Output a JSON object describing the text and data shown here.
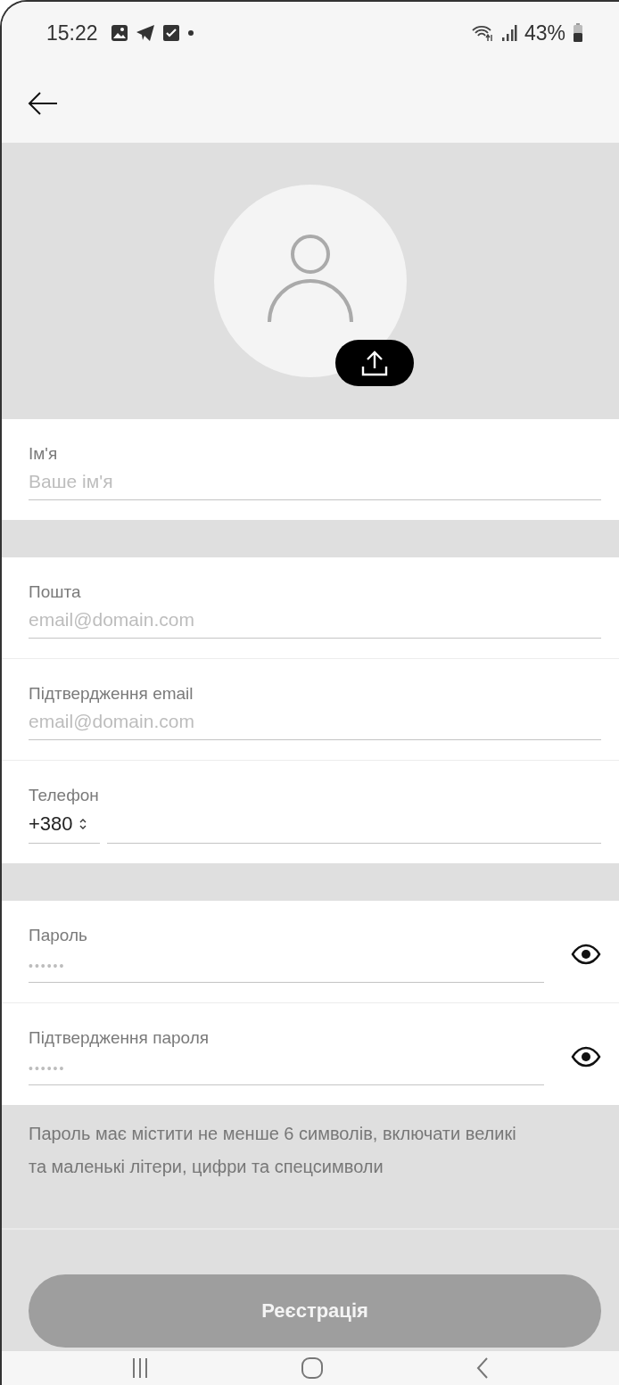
{
  "status_bar": {
    "time": "15:22",
    "battery": "43%"
  },
  "avatar": {
    "upload": true
  },
  "groups": [
    {
      "fields": [
        {
          "kind": "text",
          "label": "Ім'я",
          "placeholder": "Ваше ім'я"
        }
      ]
    },
    {
      "fields": [
        {
          "kind": "text",
          "label": "Пошта",
          "placeholder": "email@domain.com"
        },
        {
          "kind": "text",
          "label": "Підтвердження email",
          "placeholder": "email@domain.com"
        },
        {
          "kind": "phone",
          "label": "Телефон",
          "code": "+380"
        }
      ]
    },
    {
      "fields": [
        {
          "kind": "password",
          "label": "Пароль",
          "placeholder": "••••••"
        },
        {
          "kind": "password",
          "label": "Підтвердження пароля",
          "placeholder": "••••••"
        }
      ]
    }
  ],
  "hint": "Пароль має містити не менше 6 символів, включати великі та маленькі літери, цифри та спецсимволи",
  "submit": {
    "label": "Реєстрація",
    "disabled": true
  }
}
